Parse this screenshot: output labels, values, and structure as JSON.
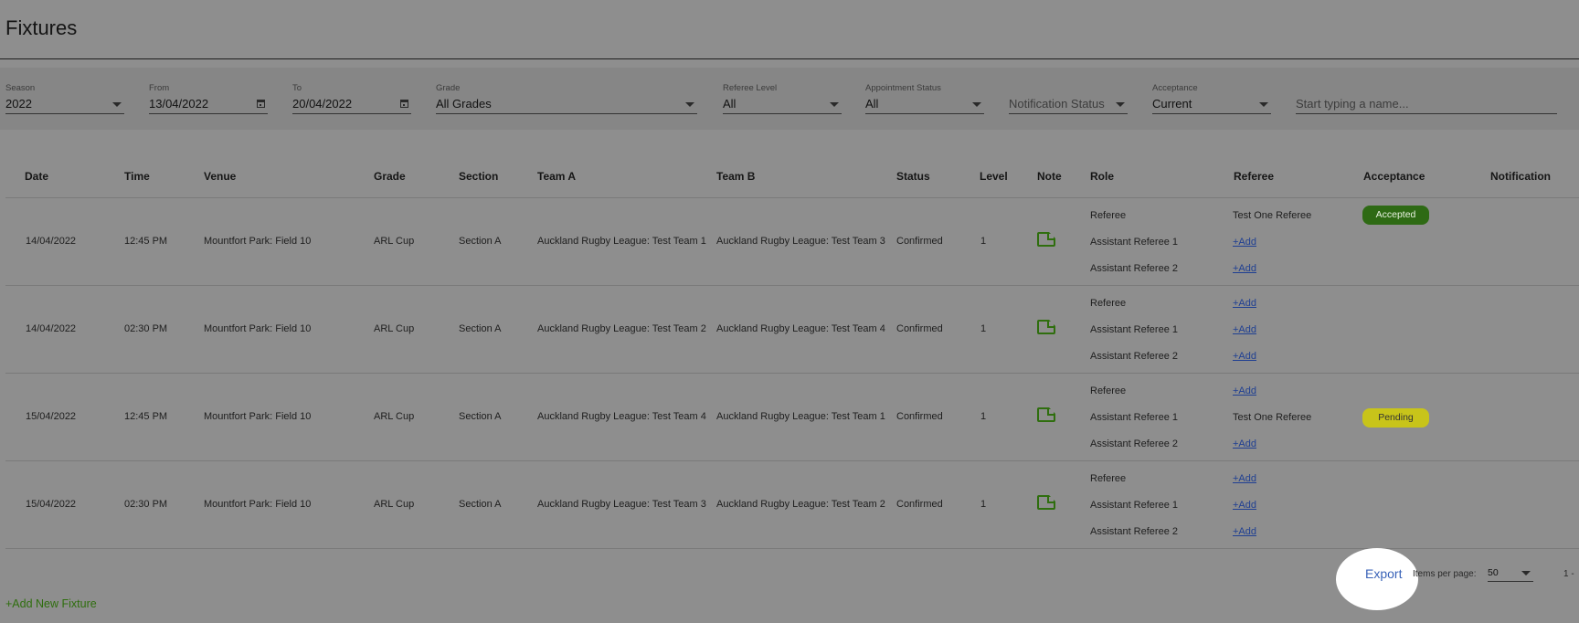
{
  "page": {
    "title": "Fixtures"
  },
  "filters": {
    "season": {
      "label": "Season",
      "value": "2022"
    },
    "from": {
      "label": "From",
      "value": "13/04/2022"
    },
    "to": {
      "label": "To",
      "value": "20/04/2022"
    },
    "grade": {
      "label": "Grade",
      "value": "All Grades"
    },
    "referee_level": {
      "label": "Referee Level",
      "value": "All"
    },
    "appointment_status": {
      "label": "Appointment Status",
      "value": "All"
    },
    "notification_status": {
      "placeholder": "Notification Status"
    },
    "acceptance": {
      "label": "Acceptance",
      "value": "Current"
    },
    "name_search": {
      "placeholder": "Start typing a name..."
    }
  },
  "table": {
    "headers": {
      "date": "Date",
      "time": "Time",
      "venue": "Venue",
      "grade": "Grade",
      "section": "Section",
      "team_a": "Team A",
      "team_b": "Team B",
      "status": "Status",
      "level": "Level",
      "note": "Note",
      "role": "Role",
      "referee": "Referee",
      "acceptance": "Acceptance",
      "notification": "Notification"
    },
    "add_label": "+Add",
    "rows": [
      {
        "date": "14/04/2022",
        "time": "12:45 PM",
        "venue": "Mountfort Park: Field 10",
        "grade": "ARL Cup",
        "section": "Section A",
        "team_a": "Auckland Rugby League: Test Team 1",
        "team_b": "Auckland Rugby League: Test Team 3",
        "status": "Confirmed",
        "level": "1",
        "roles": [
          "Referee",
          "Assistant Referee 1",
          "Assistant Referee 2"
        ],
        "referees": [
          "Test One Referee",
          "+Add",
          "+Add"
        ],
        "acceptance": "Accepted"
      },
      {
        "date": "14/04/2022",
        "time": "02:30 PM",
        "venue": "Mountfort Park: Field 10",
        "grade": "ARL Cup",
        "section": "Section A",
        "team_a": "Auckland Rugby League: Test Team 2",
        "team_b": "Auckland Rugby League: Test Team 4",
        "status": "Confirmed",
        "level": "1",
        "roles": [
          "Referee",
          "Assistant Referee 1",
          "Assistant Referee 2"
        ],
        "referees": [
          "+Add",
          "+Add",
          "+Add"
        ],
        "acceptance": ""
      },
      {
        "date": "15/04/2022",
        "time": "12:45 PM",
        "venue": "Mountfort Park: Field 10",
        "grade": "ARL Cup",
        "section": "Section A",
        "team_a": "Auckland Rugby League: Test Team 4",
        "team_b": "Auckland Rugby League: Test Team 1",
        "status": "Confirmed",
        "level": "1",
        "roles": [
          "Referee",
          "Assistant Referee 1",
          "Assistant Referee 2"
        ],
        "referees": [
          "+Add",
          "Test One Referee",
          "+Add"
        ],
        "acceptance": "Pending"
      },
      {
        "date": "15/04/2022",
        "time": "02:30 PM",
        "venue": "Mountfort Park: Field 10",
        "grade": "ARL Cup",
        "section": "Section A",
        "team_a": "Auckland Rugby League: Test Team 3",
        "team_b": "Auckland Rugby League: Test Team 2",
        "status": "Confirmed",
        "level": "1",
        "roles": [
          "Referee",
          "Assistant Referee 1",
          "Assistant Referee 2"
        ],
        "referees": [
          "+Add",
          "+Add",
          "+Add"
        ],
        "acceptance": ""
      }
    ]
  },
  "footer": {
    "export_label": "Export",
    "items_per_page_label": "Items per page:",
    "items_per_page_value": "50",
    "range_text": "1 -"
  },
  "add_fixture_label": "+Add New Fixture",
  "colors": {
    "accepted": "#2e6a14",
    "pending": "#c8c41a",
    "link": "#1f3f92",
    "add_fixture": "#2f6e0e",
    "note_icon": "#2f6e0e",
    "export": "#3a63b8"
  }
}
